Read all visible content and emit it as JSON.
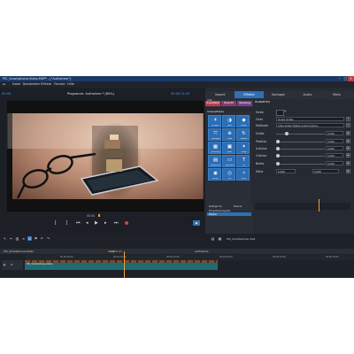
{
  "window": {
    "title": "PIC_Smartphone-Video.MEP* - [\"Aufnahme\"]"
  },
  "menu": [
    "Datei",
    "Bearbeiten",
    "Effekte",
    "Fenster",
    "Hilfe"
  ],
  "preview": {
    "header_title": "Programm: Aufnahme * (60%)",
    "timecode_left": "00:00",
    "timecode_right": "00:00:11:03"
  },
  "tabs": [
    "Import",
    "Effekte",
    "Vorlagen",
    "Audio",
    "Meta"
  ],
  "active_tab": "Effekte",
  "sub_categories": [
    "Videoeffekte",
    "Stereo3D",
    "Übergänge",
    "Bewegung"
  ],
  "effects": {
    "list_title": "Alle",
    "group_title": "Videoeffekte",
    "items": [
      {
        "label": "Helligkeit",
        "icon": "sun-icon",
        "glyph": "☀"
      },
      {
        "label": "Farbe",
        "icon": "palette-icon",
        "glyph": "◑"
      },
      {
        "label": "Schärfe",
        "icon": "sharpen-icon",
        "glyph": "◆"
      },
      {
        "label": "Bewegung",
        "icon": "motion-icon",
        "glyph": "⤧"
      },
      {
        "label": "Zoom",
        "icon": "zoom-icon",
        "glyph": "⊕"
      },
      {
        "label": "Rotation",
        "icon": "rotate-icon",
        "glyph": "↻"
      },
      {
        "label": "Verzerrung",
        "icon": "distort-icon",
        "glyph": "▦"
      },
      {
        "label": "Maske",
        "icon": "mask-icon",
        "glyph": "▣"
      },
      {
        "label": "Design",
        "icon": "design-icon",
        "glyph": "✦"
      },
      {
        "label": "Stabilisieren",
        "icon": "stabilize-icon",
        "glyph": "▤"
      },
      {
        "label": "Bild-in-Bild",
        "icon": "pip-icon",
        "glyph": "▭"
      },
      {
        "label": "Titel",
        "icon": "title-icon",
        "glyph": "T"
      },
      {
        "label": "Blende",
        "icon": "aperture-icon",
        "glyph": "◉"
      },
      {
        "label": "Zeit",
        "icon": "clock-icon",
        "glyph": "◷"
      },
      {
        "label": "Effekt",
        "icon": "fx-icon",
        "glyph": "✧"
      }
    ]
  },
  "properties": {
    "title": "Aussehen",
    "labels": [
      "Farbe",
      "Form",
      "Methode",
      "Größe",
      "Position",
      "X-Achse",
      "Y-Achse",
      "Breite",
      "Höhe"
    ],
    "form_value": "Ovale Größe",
    "methode_value": "Alles außer Maske ausschneiden",
    "size_value": "0,000",
    "x_value": "0,000",
    "y_value": "0,000",
    "width_value": "0,000",
    "height_a": "0,000",
    "height_b": "0,000"
  },
  "layers": {
    "col1": "Kategorie",
    "col2": "Ebene",
    "rows": [
      "Eingabe/Ausgabe",
      "Maske"
    ]
  },
  "timeline": {
    "track_tabs": [
      "PIC_Smartphone-Video",
      "Leer",
      "Aufnahme"
    ],
    "clip_label": "PIC_Smartphone-Video",
    "file_label": "PIC_Smartphone.mp4",
    "playhead_tc": "00:00:11:03",
    "ruler_marks": [
      "00:00:05:00",
      "00:00:10:00",
      "00:00:15:00",
      "00:00:20:00",
      "00:00:25:00",
      "00:00:30:00"
    ]
  },
  "colors": {
    "accent": "#2f6fb6",
    "panel": "#262a32",
    "clip": "#1f6b74",
    "playhead": "#f2a23a",
    "rec": "#e0403a"
  }
}
